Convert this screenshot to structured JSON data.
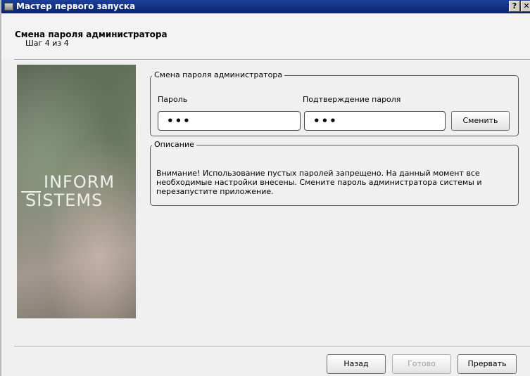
{
  "window": {
    "title": "Мастер первого запуска",
    "help_label": "?",
    "close_label": "✕"
  },
  "header": {
    "title": "Смена пароля администратора",
    "step": "Шаг 4 из 4"
  },
  "brand": {
    "line1": "INFORM",
    "line2": "SISTEMS"
  },
  "password_group": {
    "caption": "Смена пароля администратора",
    "password_label": "Пароль",
    "password_value": "•••",
    "confirm_label": "Подтверждение пароля",
    "confirm_value": "•••",
    "change_button": "Сменить"
  },
  "description_group": {
    "caption": "Описание",
    "text": "Внимание! Использование пустых паролей запрещено. На данный момент все необходимые настройки внесены. Смените пароль администратора системы и перезапустите приложение."
  },
  "footer": {
    "back_button": "Назад",
    "finish_button": "Готово",
    "cancel_button": "Прервать"
  }
}
